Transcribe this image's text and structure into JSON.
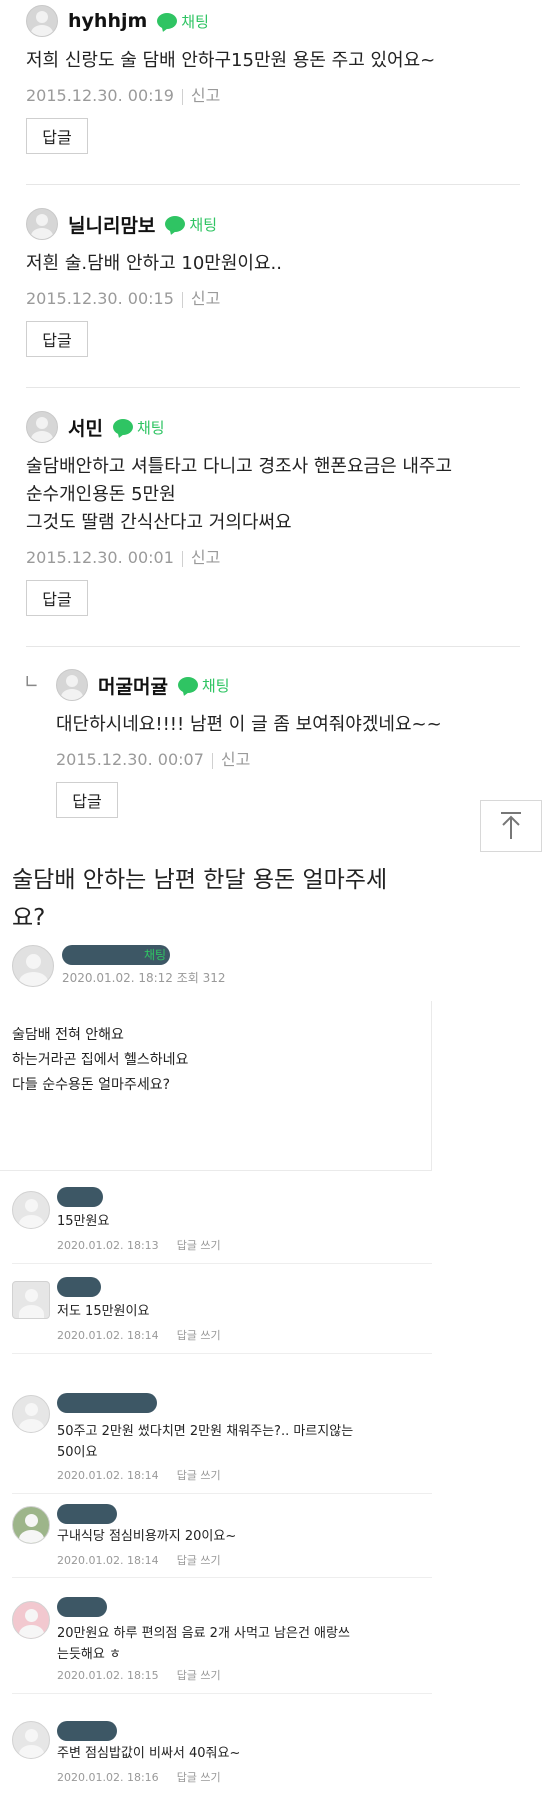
{
  "top_comments": [
    {
      "nick": "hyhhjm",
      "chat": "채팅",
      "lines": [
        "저희 신랑도 술 담배 안하구15만원 용돈 주고 있어요~"
      ],
      "date": "2015.12.30. 00:19",
      "report": "신고",
      "reply": "답글"
    },
    {
      "nick": "닐니리맘보",
      "chat": "채팅",
      "lines": [
        "저흰 술.담배 안하고 10만원이요.."
      ],
      "date": "2015.12.30. 00:15",
      "report": "신고",
      "reply": "답글"
    },
    {
      "nick": "서민",
      "chat": "채팅",
      "lines": [
        "술담배안하고 셔틀타고 다니고 경조사 핸폰요금은 내주고",
        "순수개인용돈 5만원",
        "그것도 딸램 간식산다고 거의다써요"
      ],
      "date": "2015.12.30. 00:01",
      "report": "신고",
      "reply": "답글"
    },
    {
      "nick": "머굴머귤",
      "chat": "채팅",
      "lines": [
        "대단하시네요!!!! 남편 이 글 좀 보여줘야겠네요~~"
      ],
      "date": "2015.12.30. 00:07",
      "report": "신고",
      "reply": "답글",
      "reply_marker": "∟"
    }
  ],
  "post": {
    "title_lines": [
      "술담배 안하는 남편 한달 용돈 얼마주세",
      "요?"
    ],
    "chat": "채팅",
    "meta": "2020.01.02. 18:12 조회 312",
    "body": [
      "술담배 전혀 안해요",
      "하는거라곤 집에서 헬스하네요",
      "다들 순수용돈 얼마주세요?"
    ]
  },
  "comments": [
    {
      "lines": [
        "15만원요"
      ],
      "date": "2020.01.02. 18:13",
      "reply": "답글 쓰기"
    },
    {
      "lines": [
        "저도 15만원이요"
      ],
      "date": "2020.01.02. 18:14",
      "reply": "답글 쓰기"
    },
    {
      "lines": [
        "50주고 2만원 썼다치면 2만원 채워주는?.. 마르지않는",
        "50이요"
      ],
      "date": "2020.01.02. 18:14",
      "reply": "답글 쓰기"
    },
    {
      "lines": [
        "구내식당 점심비용까지 20이요~"
      ],
      "date": "2020.01.02. 18:14",
      "reply": "답글 쓰기"
    },
    {
      "lines": [
        "20만원요 하루 편의점 음료 2개 사먹고 남은건 애랑쓰",
        "는듯해요 ㅎ"
      ],
      "date": "2020.01.02. 18:15",
      "reply": "답글 쓰기"
    },
    {
      "lines": [
        "주변 점심밥값이 비싸서 40줘요~"
      ],
      "date": "2020.01.02. 18:16",
      "reply": "답글 쓰기"
    }
  ],
  "colors": {
    "chat_green": "#2fc463",
    "meta_gray": "#9a9a9a",
    "scribble": "#3d5765"
  },
  "icons": {
    "scroll_top": "arrow-up-icon",
    "chat": "chat-bubble-icon"
  }
}
